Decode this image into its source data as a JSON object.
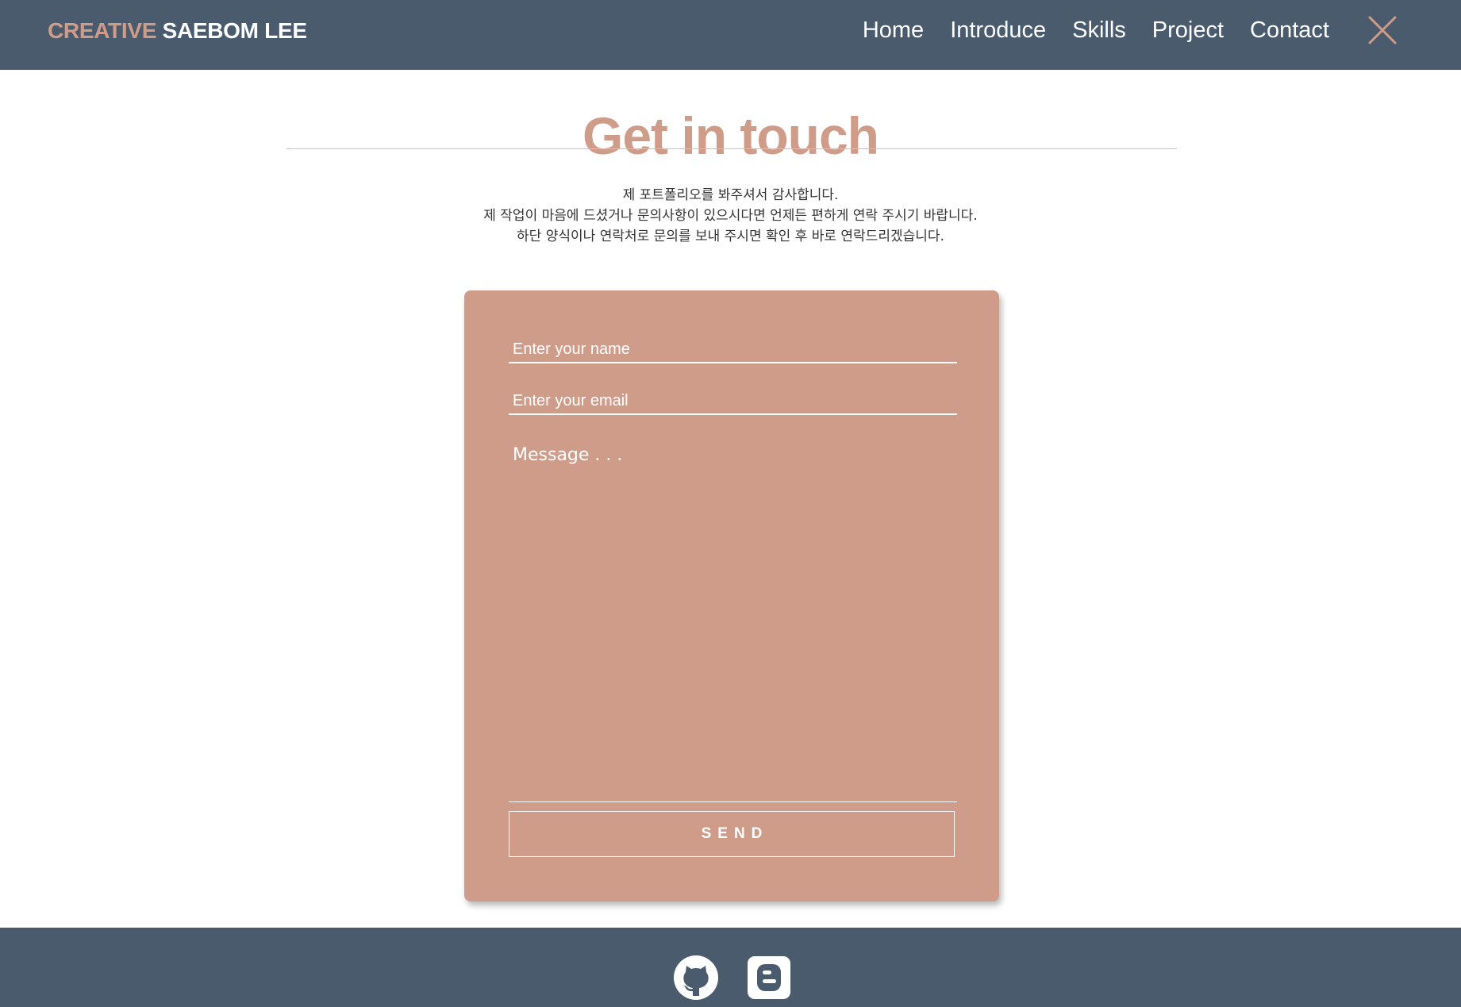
{
  "header": {
    "brand_prefix": "CREATIVE",
    "brand_name": "SAEBOM LEE",
    "nav": [
      "Home",
      "Introduce",
      "Skills",
      "Project",
      "Contact"
    ],
    "close_icon": "close-icon"
  },
  "contact": {
    "title": "Get in touch",
    "intro_lines": [
      "제 포트폴리오를 봐주셔서 감사합니다.",
      "제 작업이 마음에 드셨거나 문의사항이 있으시다면 언제든 편하게 연락 주시기 바랍니다.",
      "하단 양식이나 연락처로 문의를 보내 주시면 확인 후 바로 연락드리겠습니다."
    ],
    "form": {
      "name_placeholder": "Enter your name",
      "email_placeholder": "Enter your email",
      "message_placeholder": "Message . . .",
      "send_label": "SEND"
    }
  },
  "footer": {
    "icons": [
      "github-icon",
      "blogger-icon"
    ]
  },
  "colors": {
    "navbar_bg": "#4a5b6d",
    "accent": "#cf9c89",
    "text_light": "#ffffff",
    "text_dark": "#333333"
  }
}
